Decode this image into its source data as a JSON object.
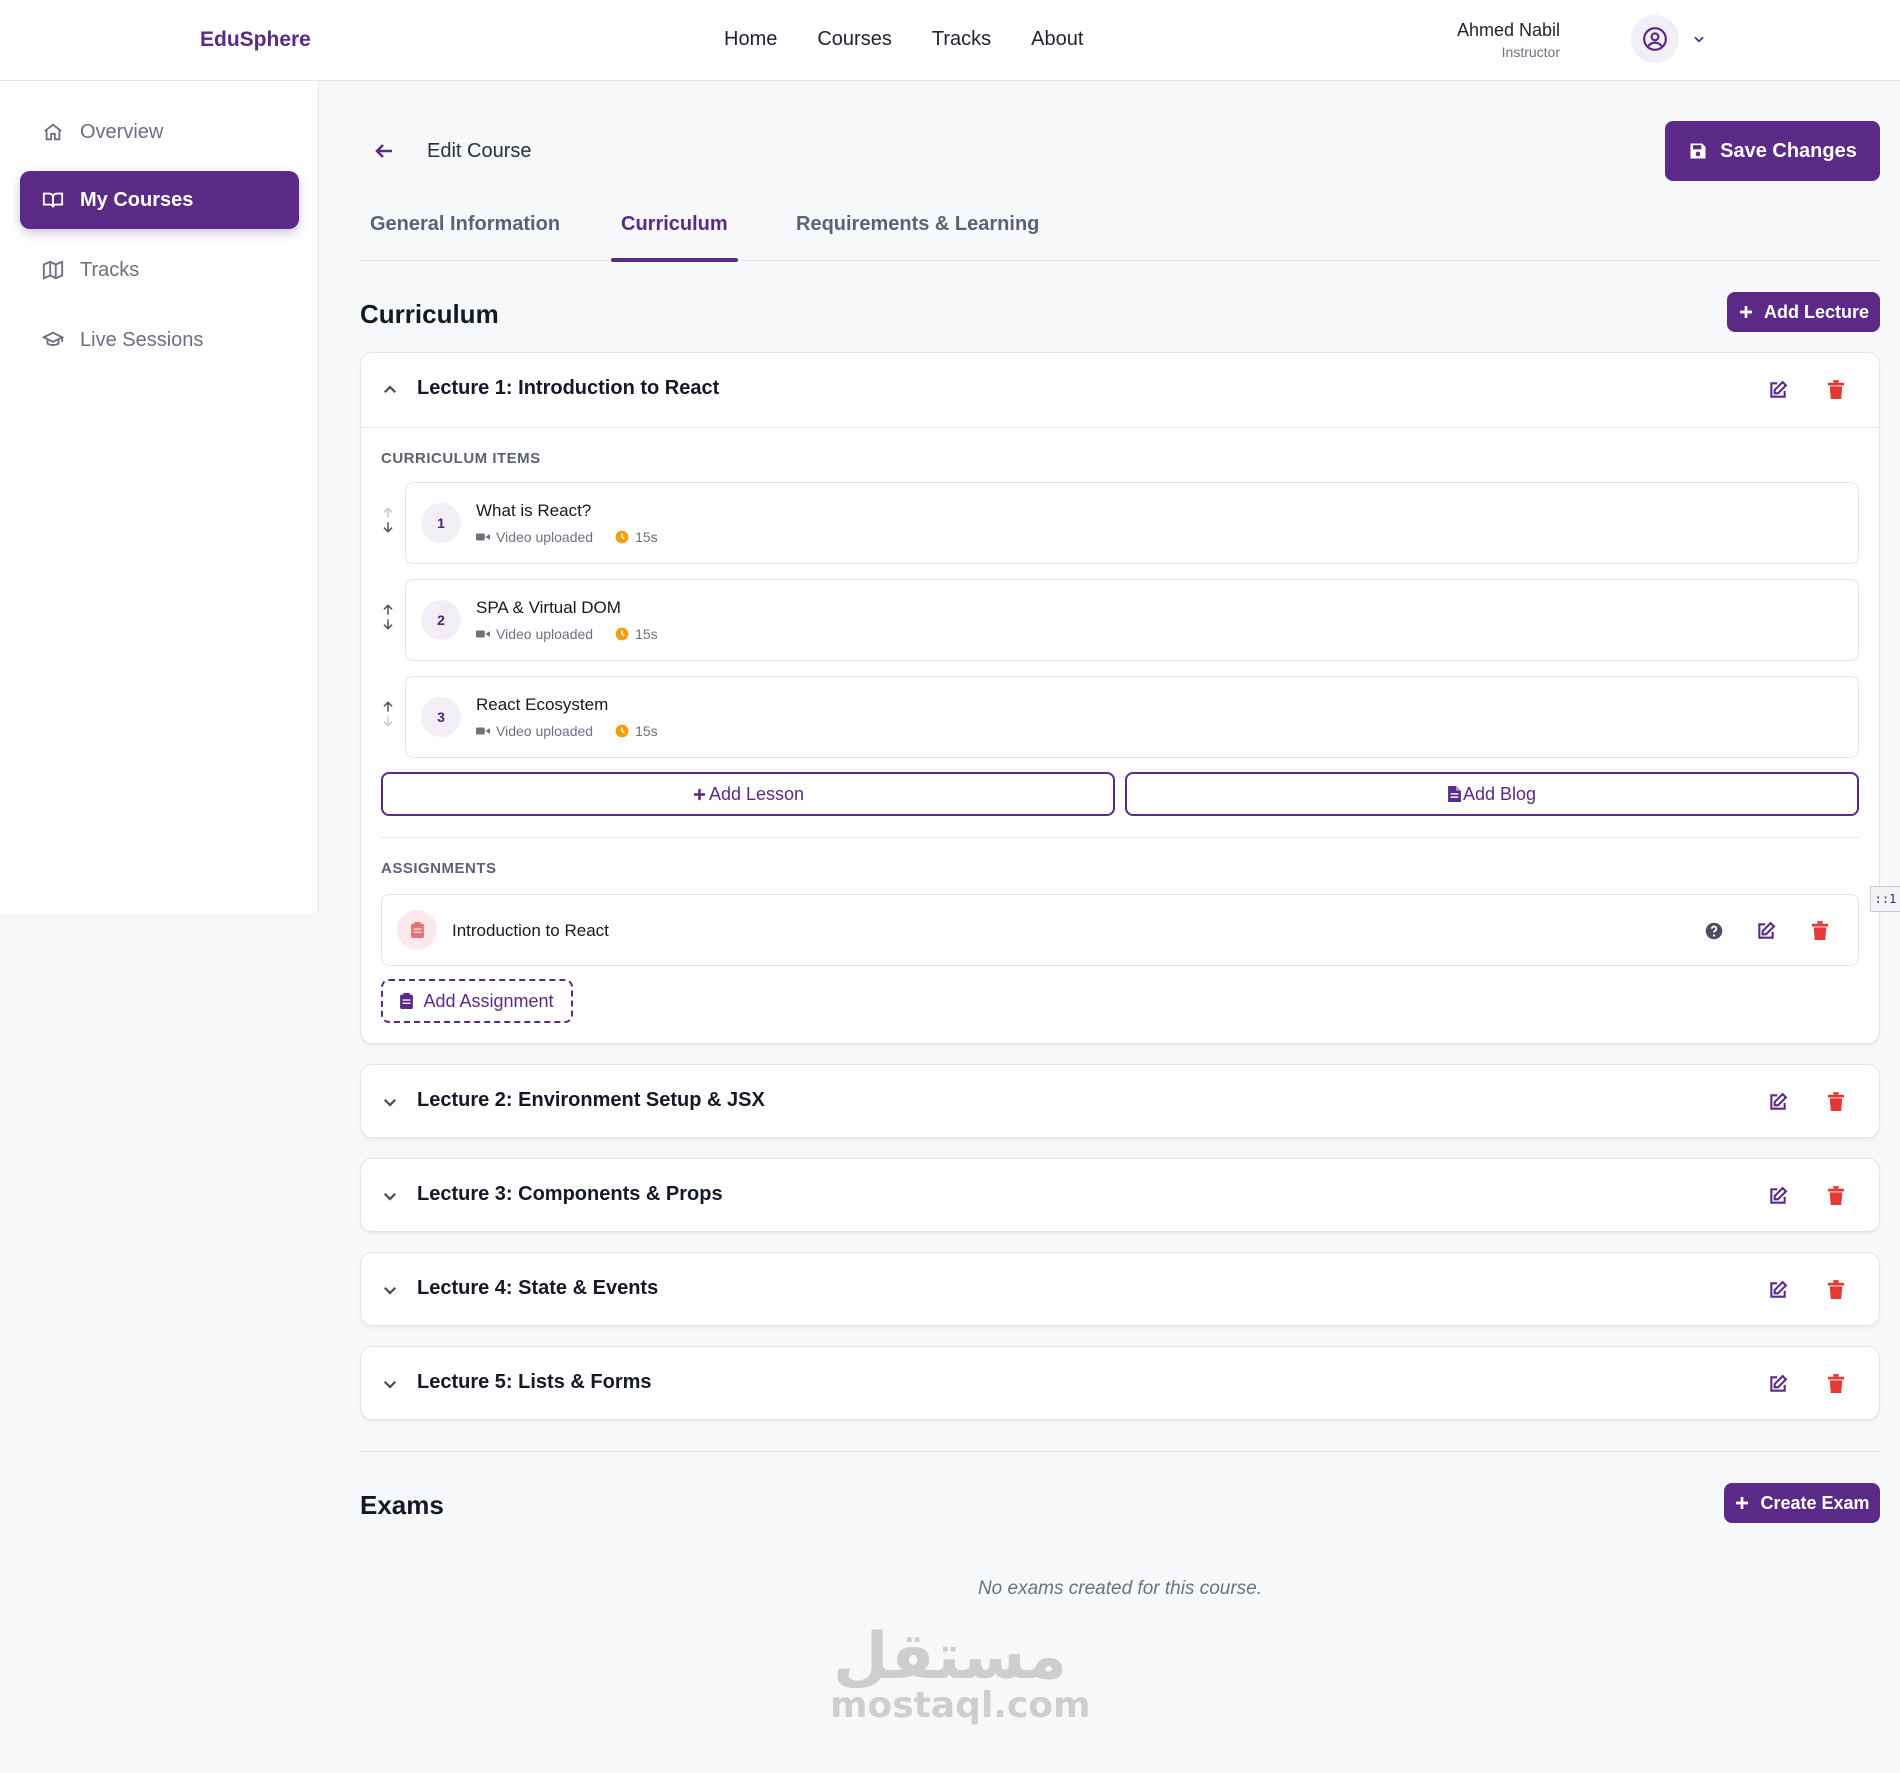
{
  "header": {
    "logo": "EduSphere",
    "nav": [
      "Home",
      "Courses",
      "Tracks",
      "About"
    ],
    "user_name": "Ahmed Nabil",
    "user_role": "Instructor"
  },
  "sidebar": {
    "items": [
      {
        "label": "Overview",
        "icon": "home-icon",
        "active": false
      },
      {
        "label": "My Courses",
        "icon": "book-open-icon",
        "active": true
      },
      {
        "label": "Tracks",
        "icon": "map-icon",
        "active": false
      },
      {
        "label": "Live Sessions",
        "icon": "graduation-cap-icon",
        "active": false
      }
    ]
  },
  "page": {
    "title": "Edit Course",
    "save_label": "Save Changes",
    "tabs": [
      "General Information",
      "Curriculum",
      "Requirements & Learning"
    ],
    "active_tab": "Curriculum"
  },
  "curriculum": {
    "title": "Curriculum",
    "add_lecture_label": "Add Lecture",
    "lectures": [
      {
        "title": "Lecture 1: Introduction to React",
        "expanded": true
      },
      {
        "title": "Lecture 2: Environment Setup & JSX",
        "expanded": false
      },
      {
        "title": "Lecture 3: Components & Props",
        "expanded": false
      },
      {
        "title": "Lecture 4: State & Events",
        "expanded": false
      },
      {
        "title": "Lecture 5: Lists & Forms",
        "expanded": false
      }
    ],
    "items_label": "CURRICULUM ITEMS",
    "items": [
      {
        "num": "1",
        "title": "What is React?",
        "status": "Video uploaded",
        "duration": "15s"
      },
      {
        "num": "2",
        "title": "SPA & Virtual DOM",
        "status": "Video uploaded",
        "duration": "15s"
      },
      {
        "num": "3",
        "title": "React Ecosystem",
        "status": "Video uploaded",
        "duration": "15s"
      }
    ],
    "add_lesson_label": "Add Lesson",
    "add_blog_label": "Add Blog",
    "assignments_label": "ASSIGNMENTS",
    "assignments": [
      {
        "title": "Introduction to React"
      }
    ],
    "add_assignment_label": "Add Assignment"
  },
  "exams": {
    "title": "Exams",
    "create_label": "Create Exam",
    "empty_text": "No exams created for this course."
  },
  "side_tab_label": "::1",
  "watermark": {
    "top": "مستقل",
    "bottom": "mostaql.com"
  },
  "colors": {
    "brand": "#5b2a86",
    "danger": "#e53935",
    "warning": "#f59e0b",
    "muted": "#6b7280"
  }
}
